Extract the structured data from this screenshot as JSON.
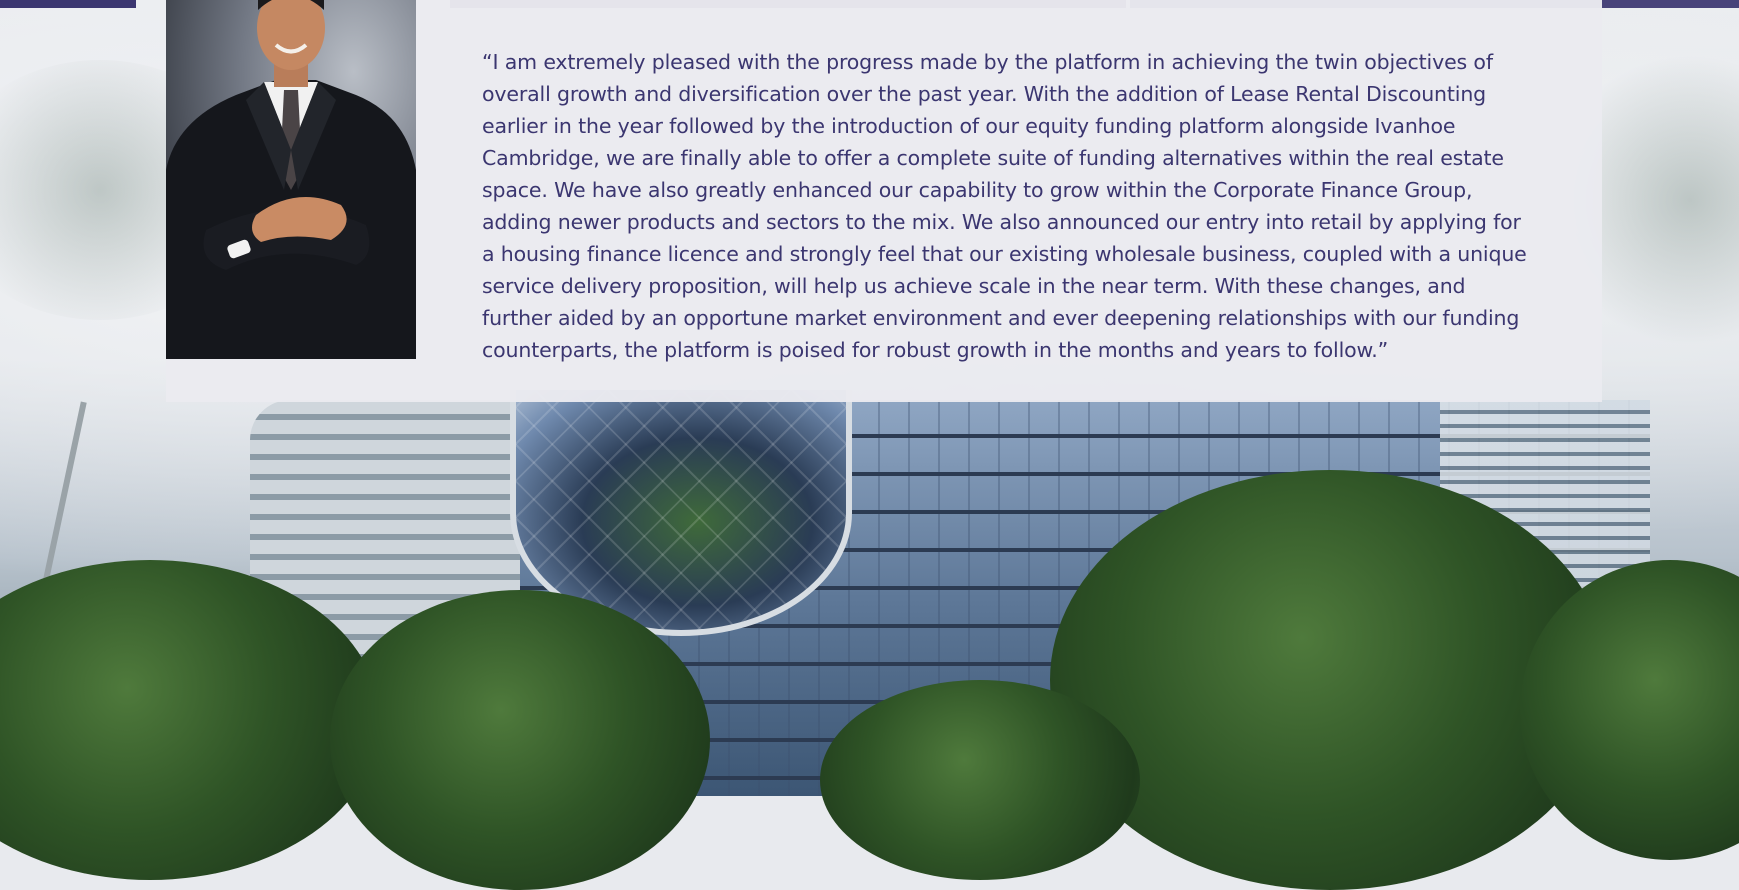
{
  "quote": {
    "text": "“I am extremely pleased with the progress made by the platform in achieving the twin objectives of overall growth and diversification over the past year. With the addition of Lease Rental Discounting earlier in the year followed by the introduction of our equity funding platform alongside Ivanhoe Cambridge, we are finally able to offer a complete suite of funding alternatives within the real estate space. We have also greatly enhanced our capability to grow within the Corporate Finance Group, adding newer products and sectors to the mix. We also announced our entry into retail by applying for a housing finance licence and strongly feel that our existing wholesale business, coupled with a unique service delivery proposition, will help us achieve scale in the near term. With these changes, and further aided by an opportune market environment and ever deepening relationships with our funding counterparts, the platform is poised for robust growth in the months and years to follow.”"
  },
  "colors": {
    "text": "#3b3670",
    "strip": "#3b3670",
    "card": "#eaeaf0"
  }
}
